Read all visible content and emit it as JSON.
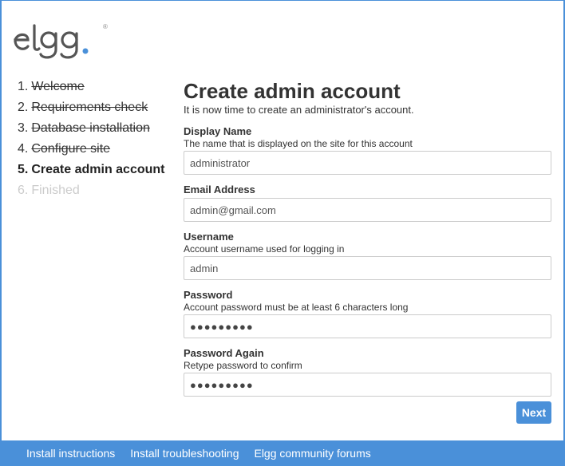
{
  "brand": {
    "logo_text": "elgg",
    "accent": "#4a90d9"
  },
  "steps": [
    {
      "num": "1.",
      "label": "Welcome",
      "state": "done"
    },
    {
      "num": "2.",
      "label": "Requirements check",
      "state": "done"
    },
    {
      "num": "3.",
      "label": "Database installation",
      "state": "done"
    },
    {
      "num": "4.",
      "label": "Configure site",
      "state": "done"
    },
    {
      "num": "5.",
      "label": "Create admin account",
      "state": "current"
    },
    {
      "num": "6.",
      "label": "Finished",
      "state": "pending"
    }
  ],
  "main": {
    "title": "Create admin account",
    "intro": "It is now time to create an administrator's account."
  },
  "form": {
    "display_name": {
      "label": "Display Name",
      "help": "The name that is displayed on the site for this account",
      "value": "administrator"
    },
    "email": {
      "label": "Email Address",
      "value": "admin@gmail.com"
    },
    "username": {
      "label": "Username",
      "help": "Account username used for logging in",
      "value": "admin"
    },
    "password": {
      "label": "Password",
      "help": "Account password must be at least 6 characters long",
      "value": "●●●●●●●●●"
    },
    "password_again": {
      "label": "Password Again",
      "help": "Retype password to confirm",
      "value": "●●●●●●●●●"
    },
    "next_label": "Next"
  },
  "footer": {
    "links": [
      "Install instructions",
      "Install troubleshooting",
      "Elgg community forums"
    ]
  }
}
